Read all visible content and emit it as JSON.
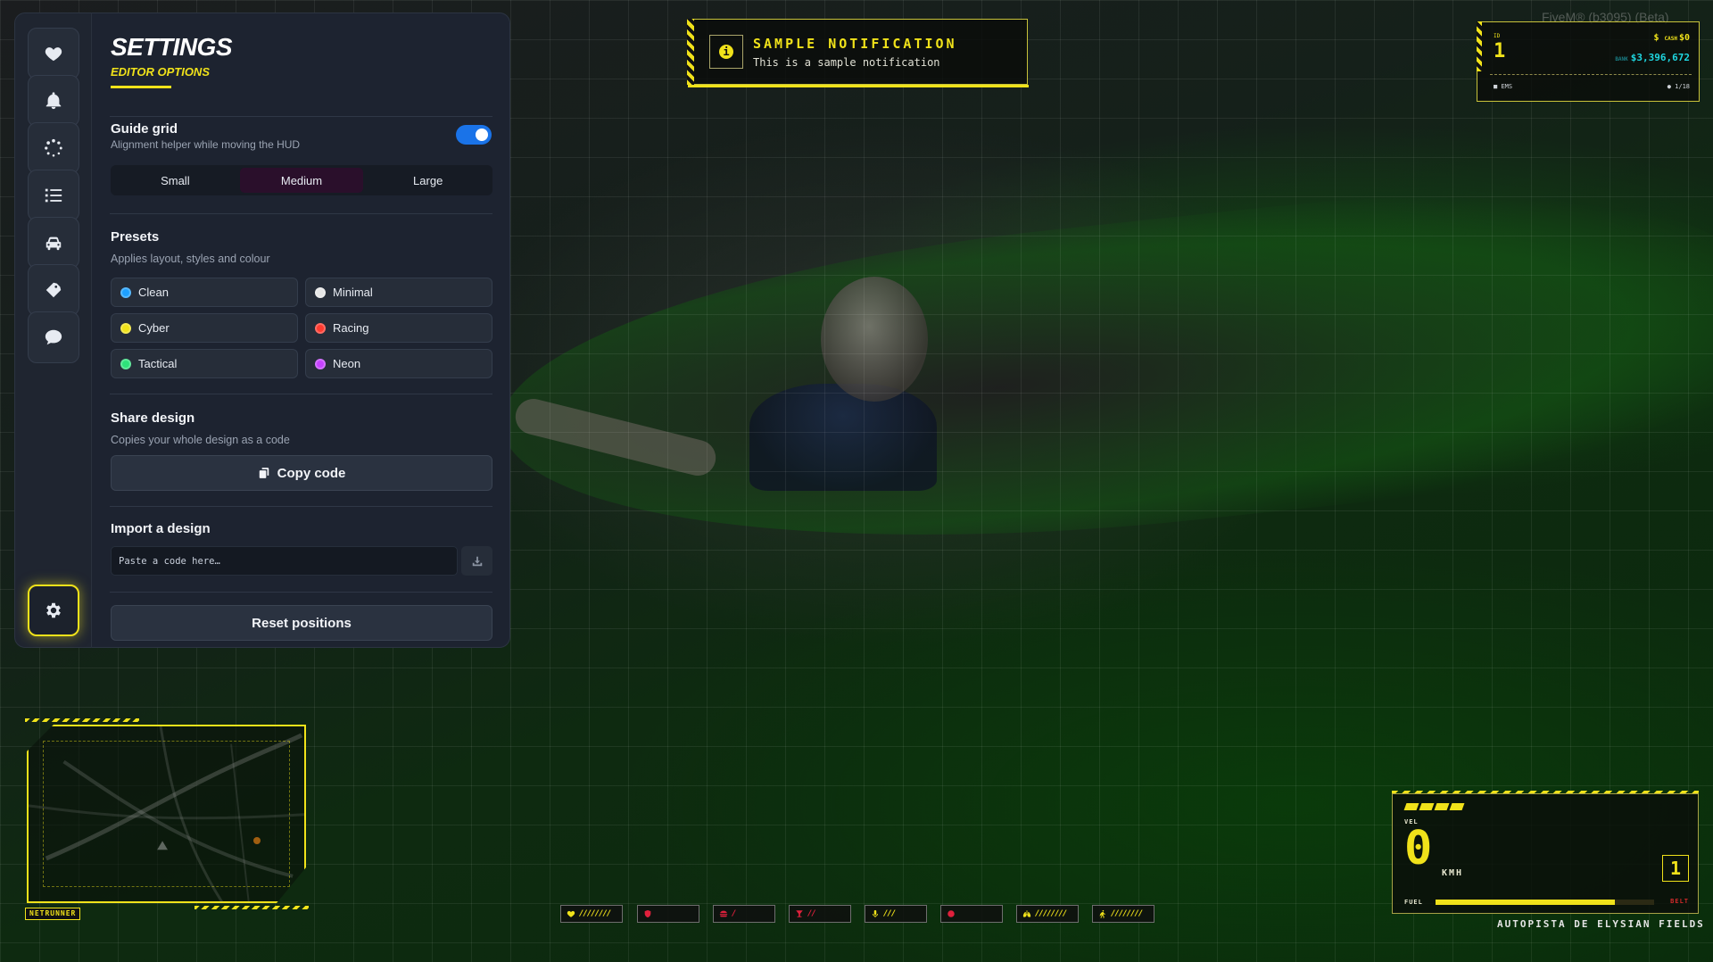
{
  "window": {
    "title": "FiveM® (b3095) (Beta)"
  },
  "sidebar": {
    "items": [
      {
        "icon": "heart-icon"
      },
      {
        "icon": "bell-icon"
      },
      {
        "icon": "spinner-icon"
      },
      {
        "icon": "list-icon"
      },
      {
        "icon": "car-icon"
      },
      {
        "icon": "tag-icon"
      },
      {
        "icon": "chat-icon"
      },
      {
        "icon": "gear-icon",
        "active": true
      }
    ]
  },
  "settings": {
    "title": "SETTINGS",
    "subtitle": "EDITOR OPTIONS",
    "guide_grid": {
      "label": "Guide grid",
      "description": "Alignment helper while moving the HUD",
      "enabled": true,
      "sizes": [
        "Small",
        "Medium",
        "Large"
      ],
      "selected": "Medium"
    },
    "presets": {
      "label": "Presets",
      "description": "Applies layout, styles and colour",
      "items": [
        {
          "label": "Clean",
          "color": "#1ea0ff"
        },
        {
          "label": "Minimal",
          "color": "#e6e6e6"
        },
        {
          "label": "Cyber",
          "color": "#f0e21a"
        },
        {
          "label": "Racing",
          "color": "#ff3b30"
        },
        {
          "label": "Tactical",
          "color": "#2ee27a"
        },
        {
          "label": "Neon",
          "color": "#c542ff"
        }
      ]
    },
    "share": {
      "label": "Share design",
      "description": "Copies your whole design as a code",
      "button": "Copy code"
    },
    "import": {
      "label": "Import a design",
      "placeholder": "Paste a code here…"
    },
    "reset_button": "Reset positions"
  },
  "notification": {
    "title": "SAMPLE NOTIFICATION",
    "text": "This is a sample notification"
  },
  "status": {
    "id_label": "ID",
    "id": "1",
    "cash_label": "CASH",
    "cash": "$0",
    "bank_label": "BANK",
    "bank": "$3,396,672",
    "job": "EMS",
    "players": "1/18"
  },
  "minimap": {
    "label": "NETRUNNER"
  },
  "indicators": [
    {
      "icon": "heart-icon",
      "color": "#f0e21a",
      "bars": "////////"
    },
    {
      "icon": "shield-icon",
      "color": "#e0203c",
      "bars": ""
    },
    {
      "icon": "burger-icon",
      "color": "#e0203c",
      "bars": "/"
    },
    {
      "icon": "drink-icon",
      "color": "#e0203c",
      "bars": "//"
    },
    {
      "icon": "mic-icon",
      "color": "#f0e21a",
      "bars": "///"
    },
    {
      "icon": "stress-icon",
      "color": "#e0203c",
      "bars": ""
    },
    {
      "icon": "lungs-icon",
      "color": "#f0e21a",
      "bars": "////////"
    },
    {
      "icon": "stamina-icon",
      "color": "#f0e21a",
      "bars": "////////"
    }
  ],
  "speedometer": {
    "vel_label": "VEL",
    "speed": "0",
    "unit": "KMH",
    "gear": "1",
    "fuel_label": "FUEL",
    "fuel_level": 0.82,
    "belt_label": "BELT",
    "rpm_segments": 4
  },
  "street": "AUTOPISTA DE ELYSIAN FIELDS"
}
